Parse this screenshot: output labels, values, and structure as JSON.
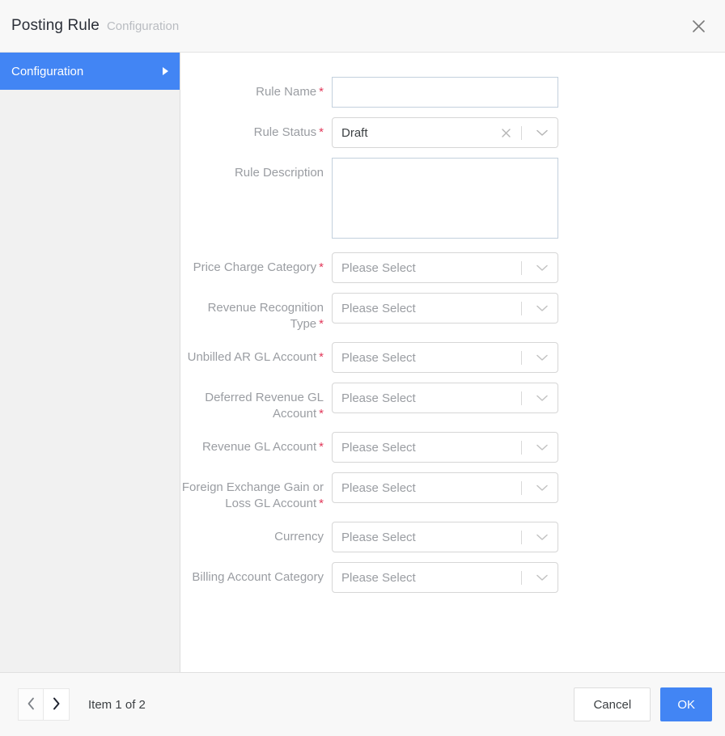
{
  "header": {
    "title": "Posting Rule",
    "subtitle": "Configuration",
    "close_icon": "close-icon"
  },
  "sidebar": {
    "items": [
      {
        "label": "Configuration",
        "active": true,
        "arrow_icon": "triangle-right-icon"
      }
    ]
  },
  "form": {
    "fields": [
      {
        "label": "Rule Name",
        "required": true,
        "control": "text",
        "value": "",
        "placeholder": ""
      },
      {
        "label": "Rule Status",
        "required": true,
        "control": "select",
        "value": "Draft",
        "is_placeholder": false,
        "has_clear": true,
        "clear_icon": "clear-x-icon",
        "caret_icon": "chevron-down-icon"
      },
      {
        "label": "Rule Description",
        "required": false,
        "control": "textarea",
        "value": "",
        "placeholder": ""
      },
      {
        "label": "Price Charge Category",
        "required": true,
        "control": "select",
        "value": "Please Select",
        "is_placeholder": true,
        "has_clear": false,
        "caret_icon": "chevron-down-icon"
      },
      {
        "label": "Revenue Recognition Type",
        "required": true,
        "control": "select",
        "value": "Please Select",
        "is_placeholder": true,
        "has_clear": false,
        "caret_icon": "chevron-down-icon"
      },
      {
        "label": "Unbilled AR GL Account",
        "required": true,
        "control": "select",
        "value": "Please Select",
        "is_placeholder": true,
        "has_clear": false,
        "caret_icon": "chevron-down-icon"
      },
      {
        "label": "Deferred Revenue GL Account",
        "required": true,
        "control": "select",
        "value": "Please Select",
        "is_placeholder": true,
        "has_clear": false,
        "caret_icon": "chevron-down-icon"
      },
      {
        "label": "Revenue GL Account",
        "required": true,
        "control": "select",
        "value": "Please Select",
        "is_placeholder": true,
        "has_clear": false,
        "caret_icon": "chevron-down-icon"
      },
      {
        "label": "Foreign Exchange Gain or Loss GL Account",
        "required": true,
        "control": "select",
        "value": "Please Select",
        "is_placeholder": true,
        "has_clear": false,
        "caret_icon": "chevron-down-icon"
      },
      {
        "label": "Currency",
        "required": false,
        "control": "select",
        "value": "Please Select",
        "is_placeholder": true,
        "has_clear": false,
        "caret_icon": "chevron-down-icon"
      },
      {
        "label": "Billing Account Category",
        "required": false,
        "control": "select",
        "value": "Please Select",
        "is_placeholder": true,
        "has_clear": false,
        "caret_icon": "chevron-down-icon"
      }
    ]
  },
  "footer": {
    "prev_icon": "chevron-left-icon",
    "next_icon": "chevron-right-icon",
    "item_counter": "Item 1 of 2",
    "cancel_label": "Cancel",
    "ok_label": "OK"
  },
  "colors": {
    "accent": "#4285f4",
    "required_star": "#e2385a",
    "label_text": "#9a9da2",
    "header_bg": "#f8f8f8",
    "sidebar_bg": "#f1f1f1"
  }
}
